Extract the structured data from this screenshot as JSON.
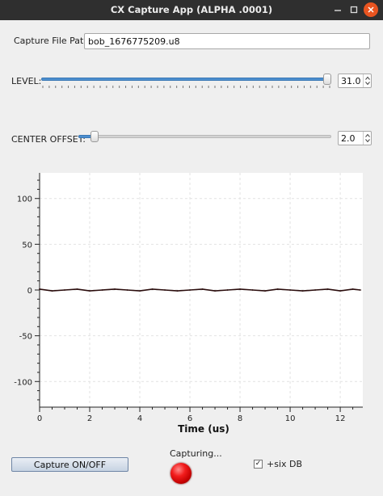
{
  "window": {
    "title": "CX Capture App  (ALPHA .0001)"
  },
  "capture_path": {
    "label": "Capture File Path:",
    "value": "bob_1676775209.u8"
  },
  "level": {
    "label": "LEVEL:",
    "value": "31.0",
    "slider_fraction": 0.999
  },
  "center_offset": {
    "label": "CENTER OFFSET:",
    "value": "2.0",
    "slider_fraction": 0.05
  },
  "controls": {
    "capture_button": "Capture ON/OFF",
    "status": "Capturing...",
    "six_db_label": "+six DB",
    "six_db_checked": true,
    "check_mark": "✓"
  },
  "colors": {
    "signal": "#2a0c0c",
    "led": "#f21c1c",
    "slider_fill": "#4d8fcf"
  },
  "chart_data": {
    "type": "line",
    "xlabel": "Time (us)",
    "ylabel": "",
    "xlim": [
      0,
      12.9
    ],
    "ylim": [
      -128,
      128
    ],
    "x_ticks": [
      0,
      2,
      4,
      6,
      8,
      10,
      12
    ],
    "y_ticks": [
      100,
      50,
      0,
      -50,
      -100
    ],
    "grid": true,
    "series": [
      {
        "x": [
          0,
          0.5,
          1,
          1.5,
          2,
          2.5,
          3,
          3.5,
          4,
          4.5,
          5,
          5.5,
          6,
          6.5,
          7,
          7.5,
          8,
          8.5,
          9,
          9.5,
          10,
          10.5,
          11,
          11.5,
          12,
          12.5,
          12.8
        ],
        "values": [
          1,
          -1,
          0,
          1,
          -1,
          0,
          1,
          0,
          -1,
          1,
          0,
          -1,
          0,
          1,
          -1,
          0,
          1,
          0,
          -1,
          1,
          0,
          -1,
          0,
          1,
          -1,
          1,
          0
        ]
      }
    ]
  }
}
